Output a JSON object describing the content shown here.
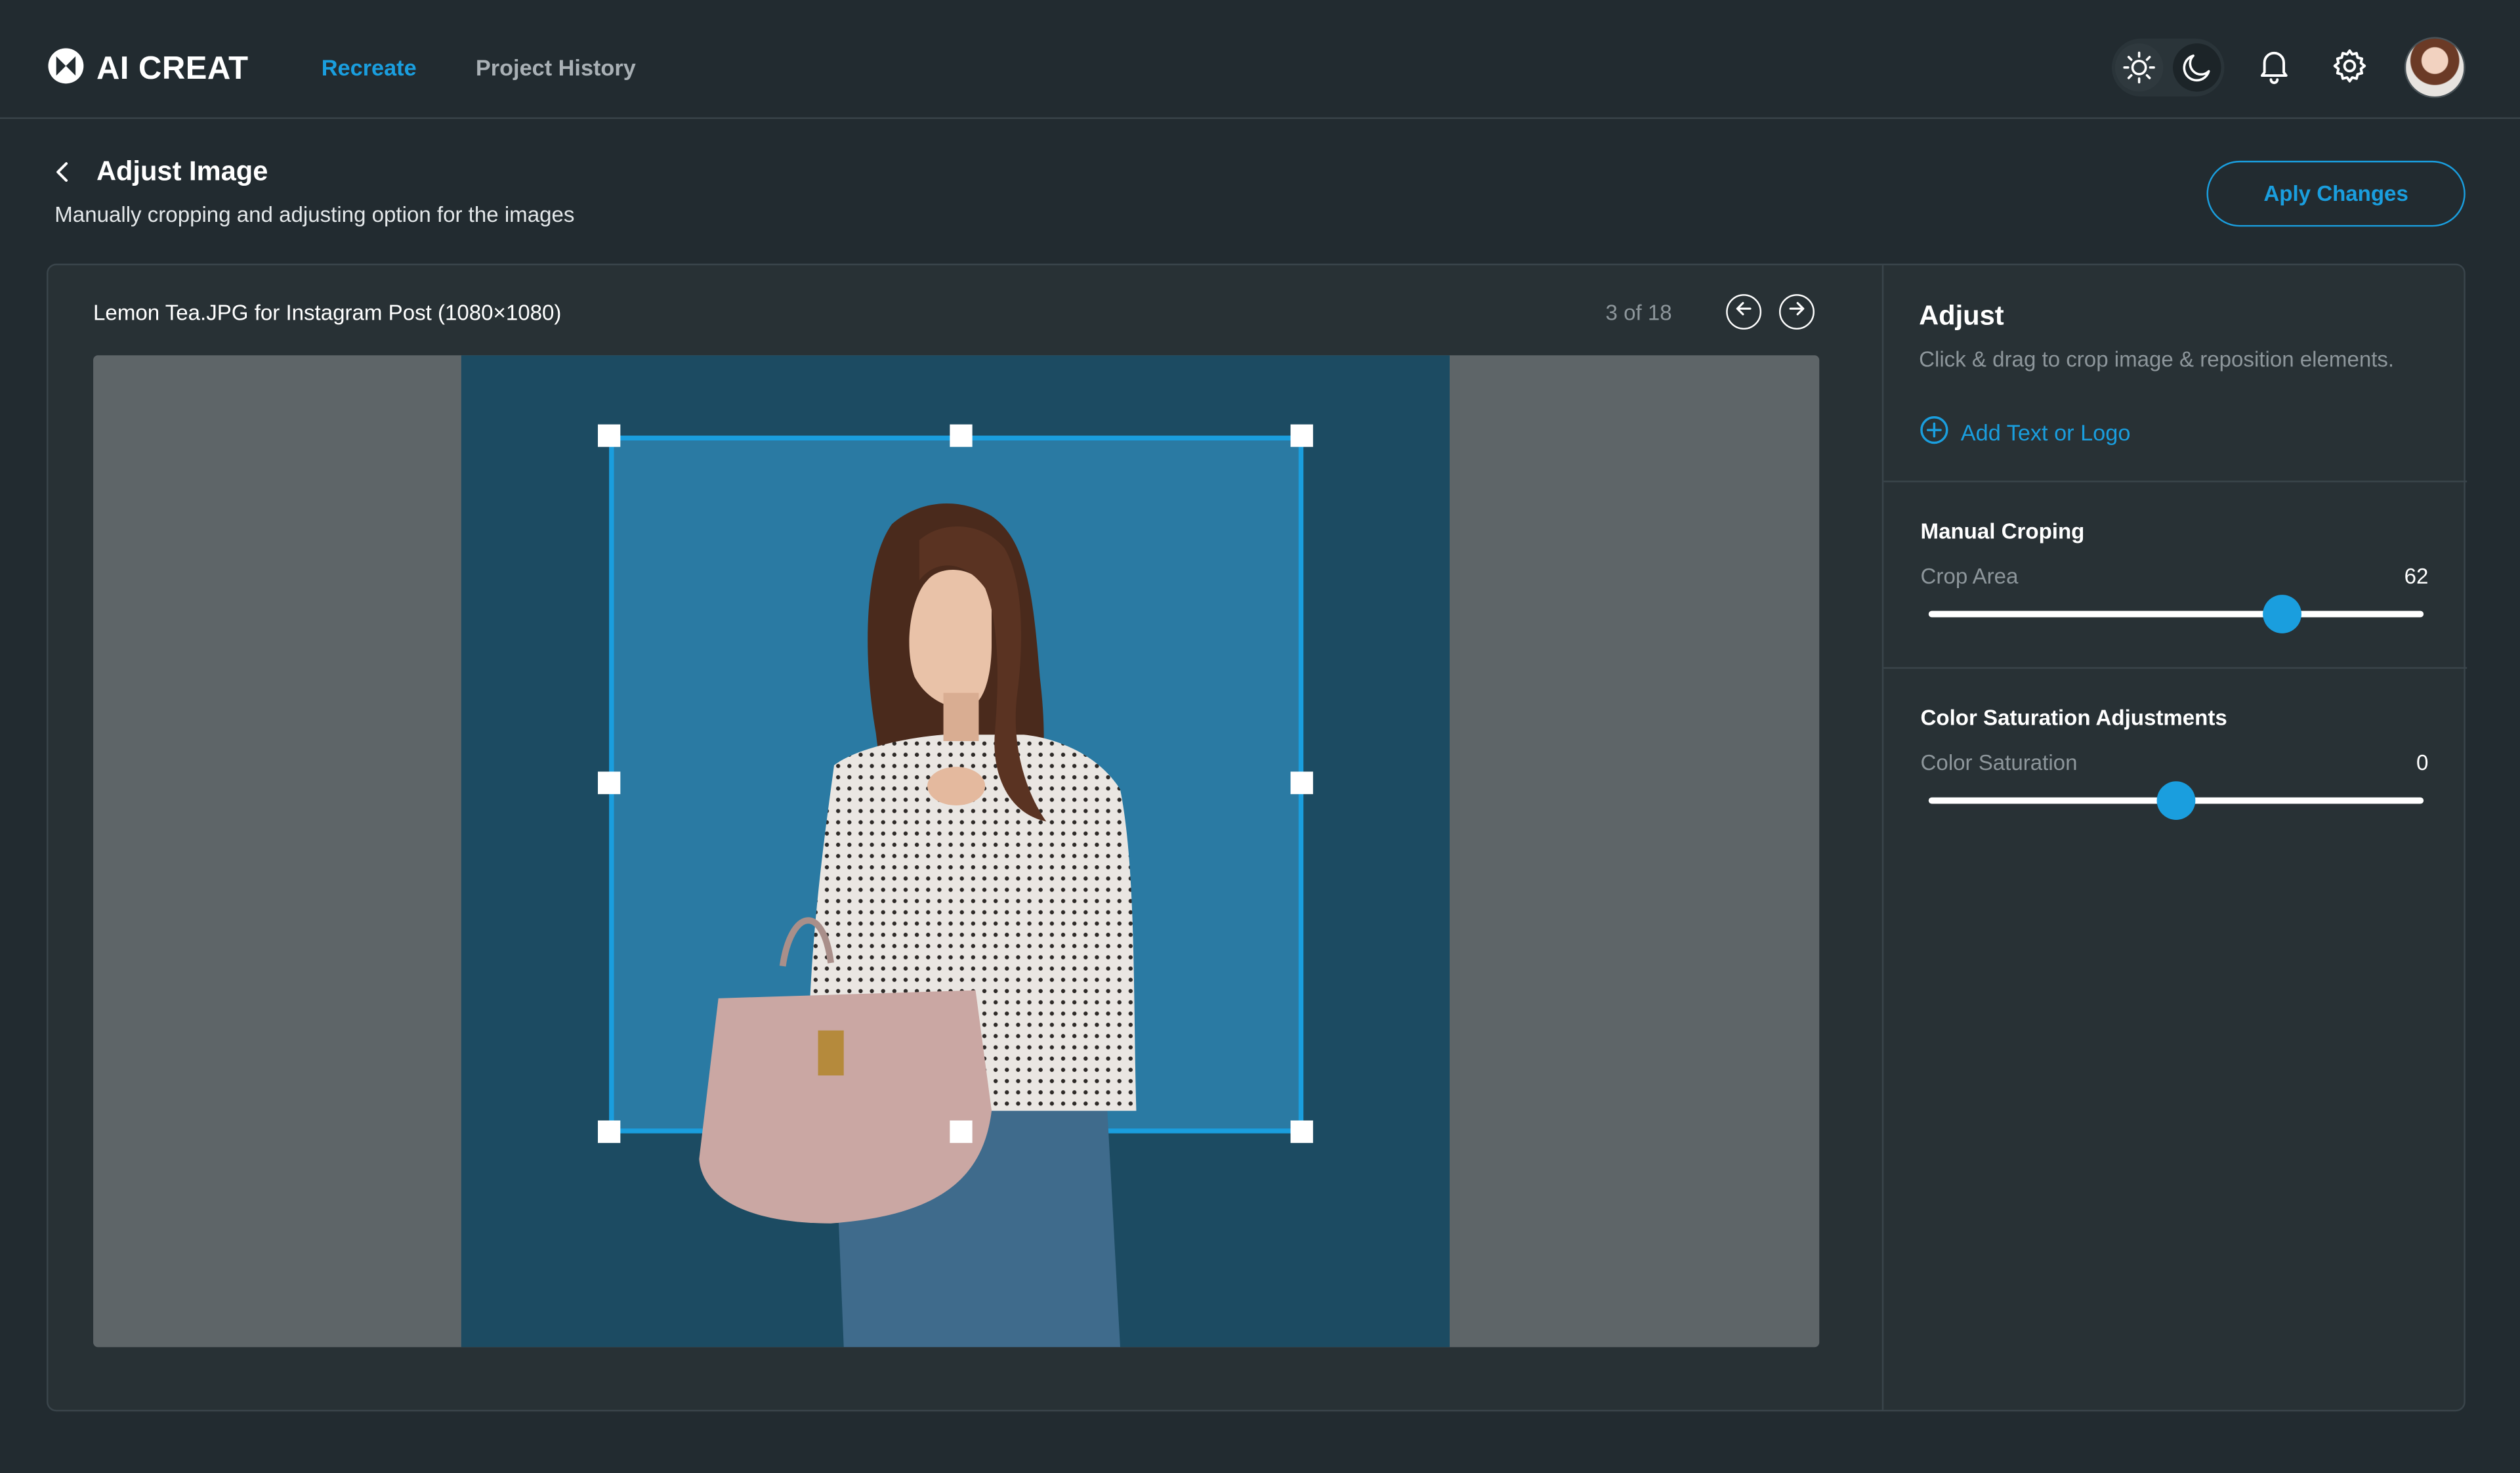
{
  "app": {
    "name": "AI CREAT",
    "colors": {
      "accent": "#1a9ede",
      "background": "#222b30",
      "panel": "#283135"
    }
  },
  "nav": {
    "items": [
      {
        "label": "Recreate",
        "active": true
      },
      {
        "label": "Project History",
        "active": false
      }
    ]
  },
  "header_icons": [
    "sun-icon",
    "moon-icon",
    "bell-icon",
    "gear-icon",
    "avatar"
  ],
  "page": {
    "title": "Adjust Image",
    "subtitle": "Manually cropping and adjusting option for the images",
    "apply_label": "Aply Changes"
  },
  "editor": {
    "file_name": "Lemon Tea.JPG for Instagram Post (1080×1080)",
    "counter": "3 of 18"
  },
  "adjust": {
    "title": "Adjust",
    "description": "Click & drag to crop image & reposition elements.",
    "add_label": "Add Text or Logo",
    "cropping": {
      "title": "Manual Croping",
      "label": "Crop Area",
      "value": "62",
      "fraction": 0.715
    },
    "saturation": {
      "title": "Color Saturation Adjustments",
      "label": "Color Saturation",
      "value": "0",
      "fraction": 0.5
    }
  }
}
